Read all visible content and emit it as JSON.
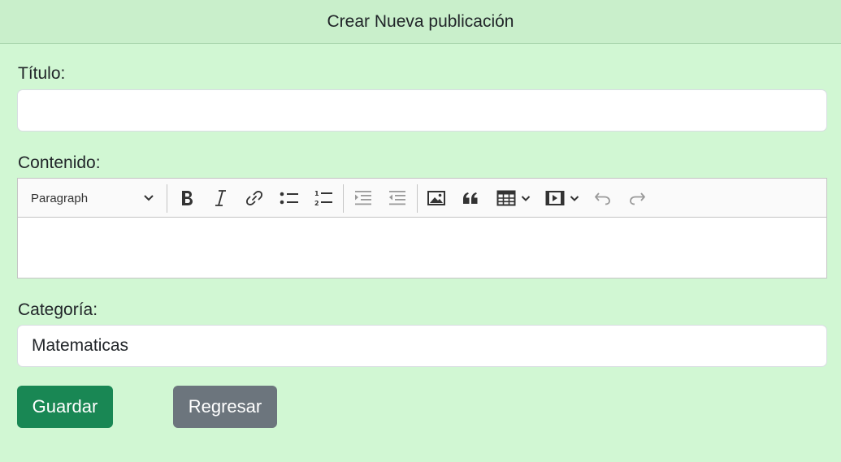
{
  "header": {
    "title": "Crear Nueva publicación"
  },
  "form": {
    "title_label": "Título:",
    "title_value": "",
    "content_label": "Contenido:",
    "category_label": "Categoría:",
    "category_value": "Matematicas"
  },
  "editor": {
    "heading_selected": "Paragraph",
    "toolbar_icons": [
      "chevron-down-icon",
      "bold-icon",
      "italic-icon",
      "link-icon",
      "bulleted-list-icon",
      "numbered-list-icon",
      "outdent-icon",
      "indent-icon",
      "image-icon",
      "blockquote-icon",
      "table-icon",
      "media-embed-icon",
      "undo-icon",
      "redo-icon"
    ]
  },
  "buttons": {
    "save_label": "Guardar",
    "back_label": "Regresar"
  },
  "colors": {
    "page_background": "#d1f7d3",
    "header_background": "#c9efcb",
    "save_button": "#198754",
    "back_button": "#6c757d"
  }
}
